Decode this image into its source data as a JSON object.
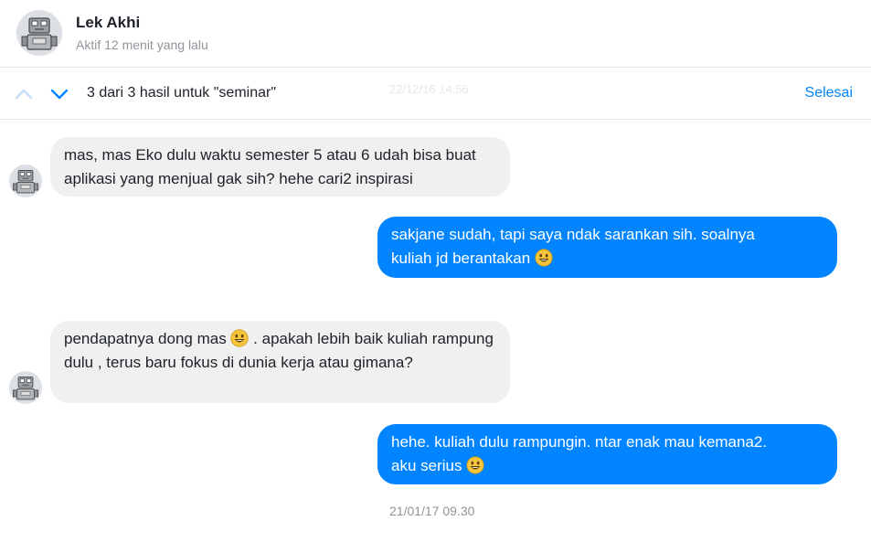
{
  "header": {
    "contact_name": "Lek Akhi",
    "status": "Aktif 12 menit yang lalu"
  },
  "search": {
    "result_text": "3 dari 3 hasil untuk \"seminar\"",
    "ghost_timestamp": "22/12/16 14.56",
    "done_label": "Selesai"
  },
  "messages": [
    {
      "sender": "contact",
      "text": "mas, mas Eko dulu waktu semester 5 atau 6 udah bisa buat aplikasi yang menjual gak sih? hehe cari2 inspirasi"
    },
    {
      "sender": "me",
      "text_line1": "sakjane sudah, tapi saya ndak sarankan sih. soalnya",
      "text_line2": "kuliah jd berantakan",
      "emoji": "smiley-emoji"
    },
    {
      "sender": "contact",
      "text_before": "pendapatnya dong mas",
      "text_after": ". apakah lebih baik kuliah rampung dulu , terus baru fokus di dunia kerja atau gimana?",
      "emoji": "smiley-emoji"
    },
    {
      "sender": "me",
      "text_line1": "hehe. kuliah dulu rampungin. ntar enak mau kemana2.",
      "text_line2": "aku serius",
      "emoji": "smiley-emoji"
    }
  ],
  "timestamp": "21/01/17 09.30",
  "colors": {
    "outgoing_bubble": "#0084ff",
    "incoming_bubble": "#f1f0f0",
    "accent": "#0084ff"
  }
}
